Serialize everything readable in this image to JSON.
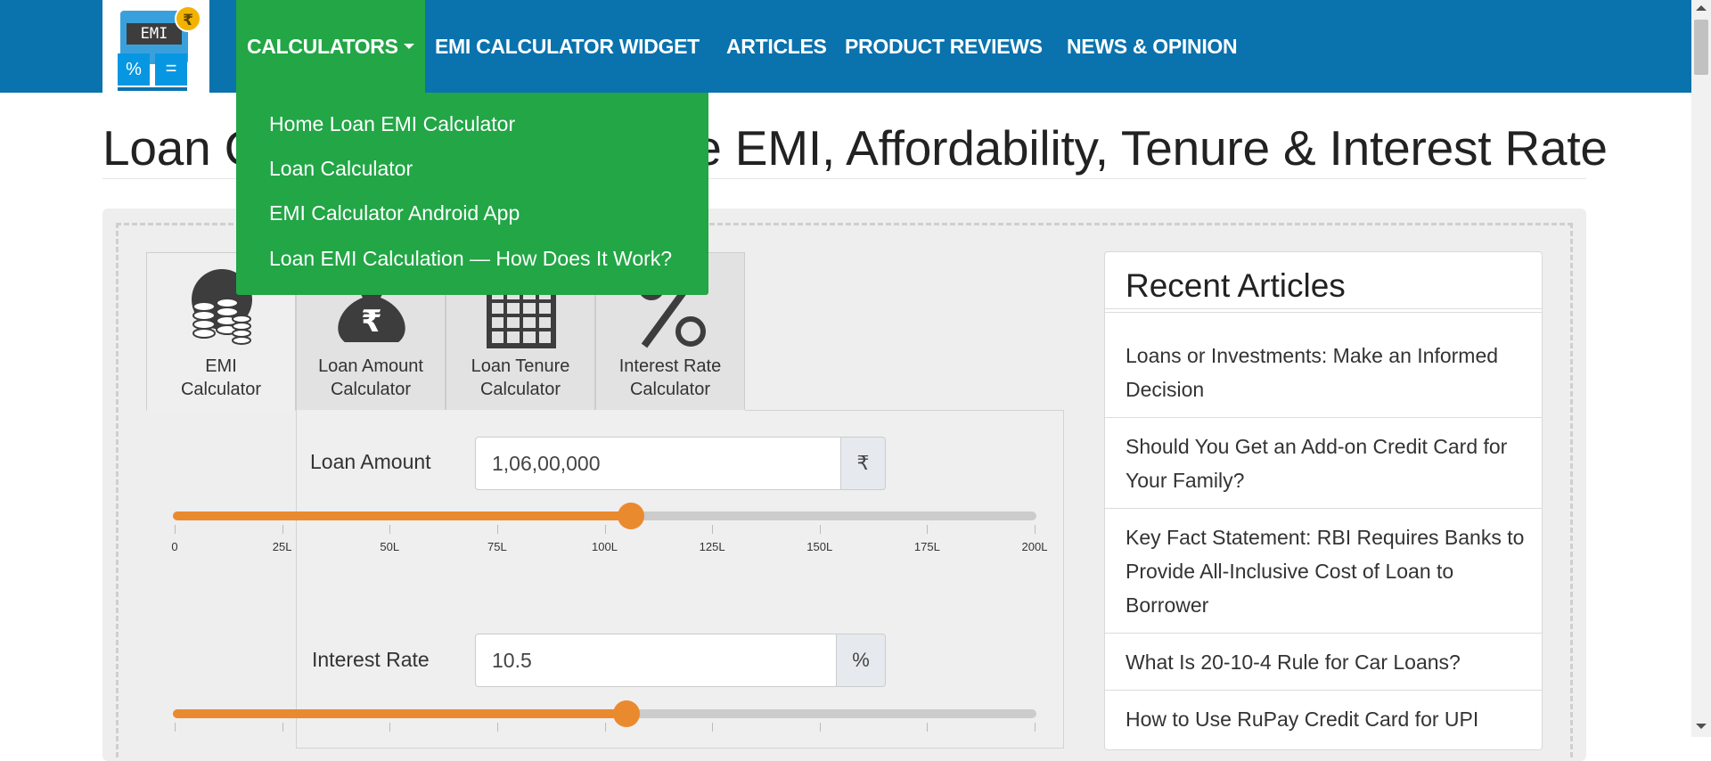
{
  "logo": {
    "screen_text": "EMI",
    "badge": "₹",
    "key_left": "%",
    "key_right": "="
  },
  "nav": {
    "items": [
      "CALCULATORS",
      "EMI CALCULATOR WIDGET",
      "ARTICLES",
      "PRODUCT REVIEWS",
      "NEWS & OPINION"
    ],
    "active_index": 0
  },
  "dropdown": {
    "items": [
      "Home Loan EMI Calculator",
      "Loan Calculator",
      "EMI Calculator Android App",
      "Loan EMI Calculation — How Does It Work?"
    ]
  },
  "page": {
    "title": "Loan Calculator — Calculate EMI, Affordability, Tenure & Interest Rate"
  },
  "tabs": [
    {
      "line1": "EMI",
      "line2": "Calculator",
      "icon": "coins-icon"
    },
    {
      "line1": "Loan Amount",
      "line2": "Calculator",
      "icon": "money-bag-icon"
    },
    {
      "line1": "Loan Tenure",
      "line2": "Calculator",
      "icon": "calendar-icon"
    },
    {
      "line1": "Interest Rate",
      "line2": "Calculator",
      "icon": "percent-icon"
    }
  ],
  "loan_amount": {
    "label": "Loan Amount",
    "value": "1,06,00,000",
    "unit": "₹",
    "slider_fraction": 0.53,
    "ticks": [
      "0",
      "25L",
      "50L",
      "75L",
      "100L",
      "125L",
      "150L",
      "175L",
      "200L"
    ]
  },
  "interest_rate": {
    "label": "Interest Rate",
    "value": "10.5",
    "unit": "%",
    "slider_fraction": 0.525
  },
  "recent": {
    "heading": "Recent Articles",
    "articles": [
      "Loans or Investments: Make an Informed Decision",
      "Should You Get an Add-on Credit Card for Your Family?",
      "Key Fact Statement: RBI Requires Banks to Provide All-Inclusive Cost of Loan to Borrower",
      "What Is 20-10-4 Rule for Car Loans?",
      "How to Use RuPay Credit Card for UPI"
    ]
  },
  "colors": {
    "nav_blue": "#0a72ad",
    "menu_green": "#22a646",
    "slider_orange": "#ea8a2f"
  }
}
